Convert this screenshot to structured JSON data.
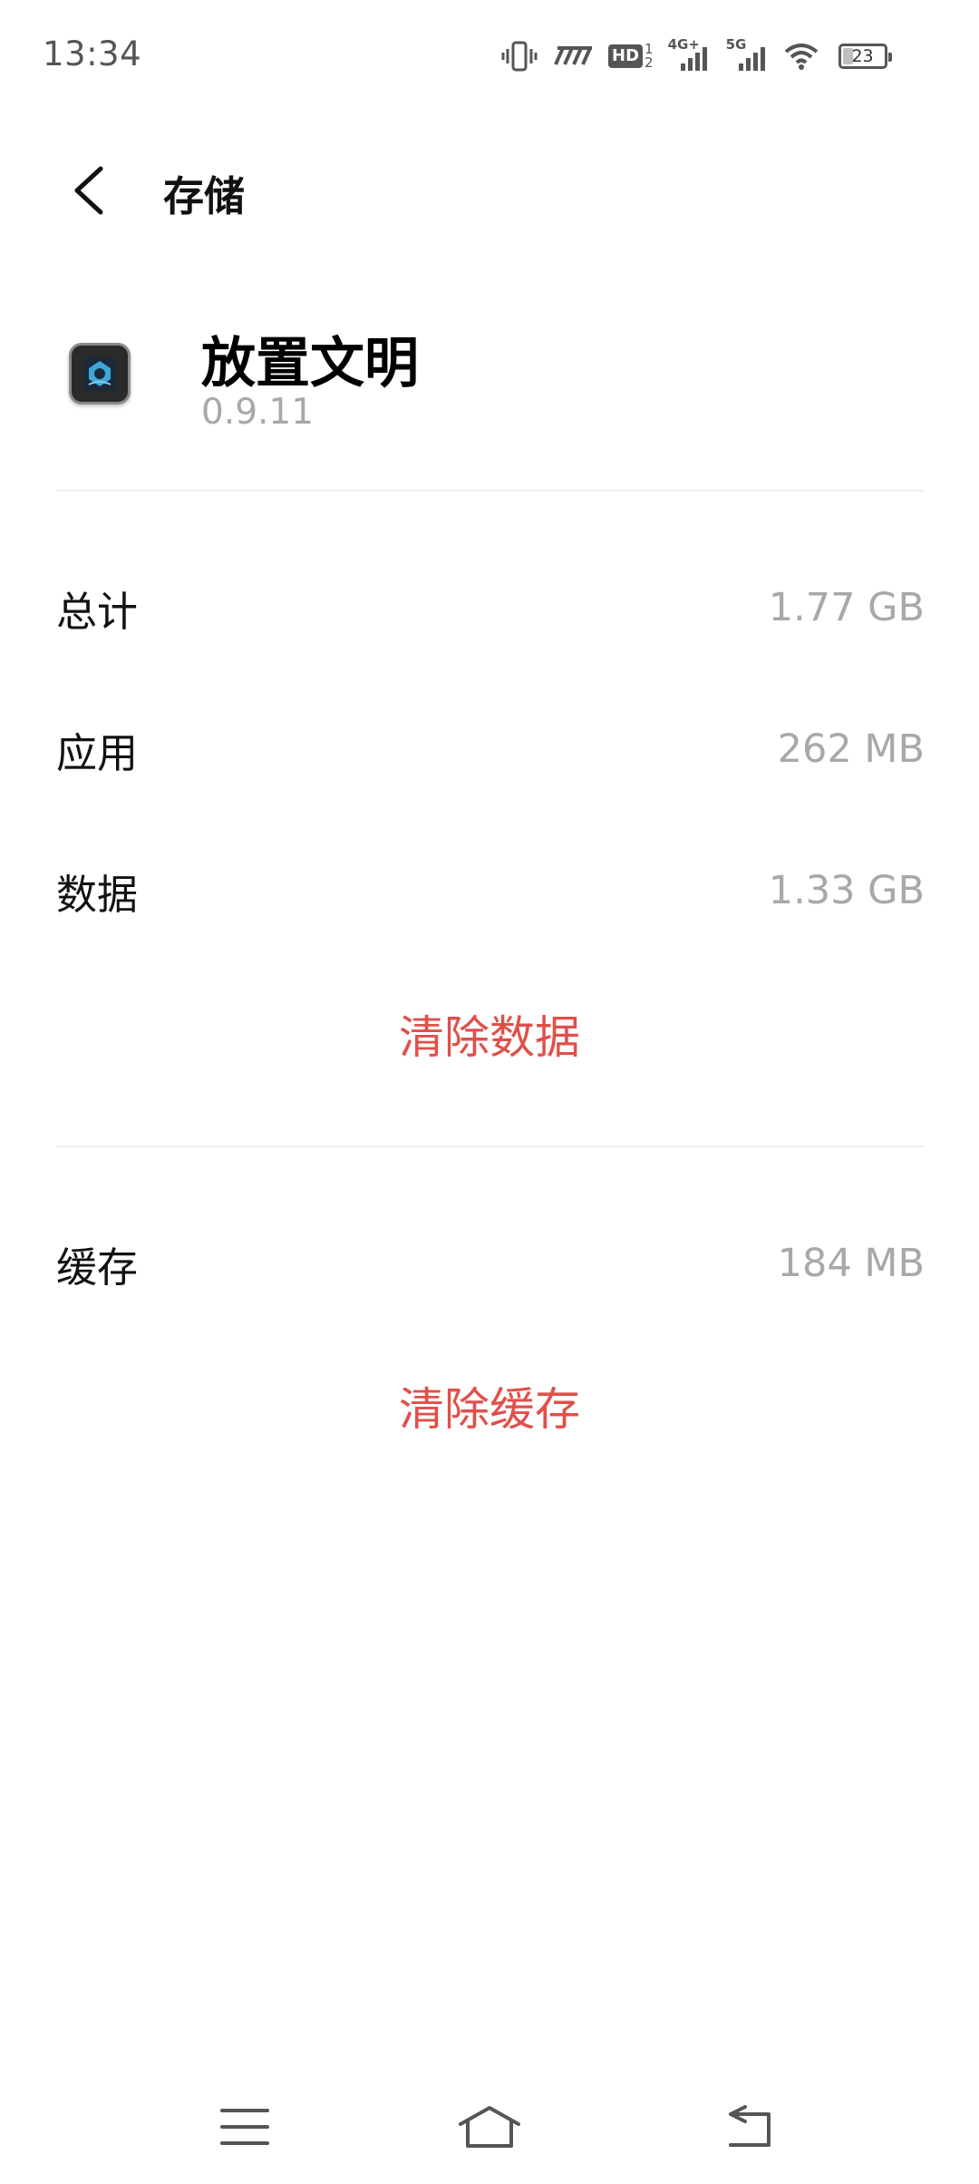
{
  "status_bar": {
    "time": "13:34",
    "battery_level": "23",
    "battery_fraction": 0.23,
    "hd_label": "HD",
    "hd_sub_top": "1",
    "hd_sub_bottom": "2",
    "network_4g": "4G+",
    "network_5g": "5G"
  },
  "header": {
    "title": "存储",
    "back_icon": "chevron-left-icon"
  },
  "app": {
    "name": "放置文明",
    "version": "0.9.11",
    "icon": "app-icon"
  },
  "storage": {
    "rows": [
      {
        "label": "总计",
        "value": "1.77 GB"
      },
      {
        "label": "应用",
        "value": "262 MB"
      },
      {
        "label": "数据",
        "value": "1.33 GB"
      }
    ],
    "clear_data_label": "清除数据",
    "cache": {
      "label": "缓存",
      "value": "184 MB"
    },
    "clear_cache_label": "清除缓存"
  },
  "colors": {
    "accent_red": "#e0504a",
    "secondary_text": "#a8a8a8",
    "primary_text": "#111111"
  },
  "nav_bar": {
    "menu_icon": "menu-icon",
    "home_icon": "home-icon",
    "back_icon": "back-arrow-icon"
  }
}
